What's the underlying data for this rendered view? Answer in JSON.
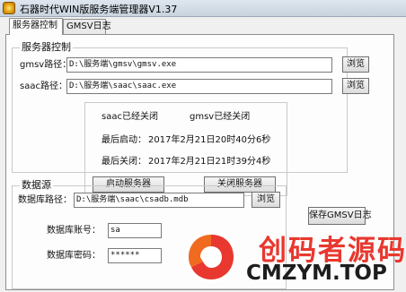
{
  "window": {
    "title": "石器时代WIN版服务端管理器V1.37"
  },
  "tabs": [
    {
      "label": "服务器控制",
      "active": true
    },
    {
      "label": "GMSV日志",
      "active": false
    }
  ],
  "server_control": {
    "group_title": "服务器控制",
    "gmsv_path_label": "gmsv路径：",
    "gmsv_path_value": "D:\\服务端\\gmsv\\gmsv.exe",
    "saac_path_label": "saac路径：",
    "saac_path_value": "D:\\服务端\\saac\\saac.exe",
    "browse_label": "浏览",
    "saac_status": "saac已经关闭",
    "gmsv_status": "gmsv已经关闭",
    "last_start_label": "最后启动：",
    "last_start_value": "2017年2月21日20时40分6秒",
    "last_stop_label": "最后关闭：",
    "last_stop_value": "2017年2月21日21时39分4秒",
    "start_button": "启动服务器",
    "stop_button": "关闭服务器"
  },
  "datasource": {
    "group_title": "数据源",
    "db_path_label": "数据库路径：",
    "db_path_value": "D:\\服务端\\saac\\csadb.mdb",
    "browse_label": "浏览",
    "account_label": "数据库账号：",
    "account_value": "sa",
    "password_label": "数据库密码：",
    "password_value": "******"
  },
  "save_log_button": "保存GMSV日志",
  "watermark": {
    "cn": "创码者源码",
    "en": "CMZYM.TOP"
  },
  "colors": {
    "watermark_red": "#e8382f",
    "titlebar": "#c8d3df"
  }
}
